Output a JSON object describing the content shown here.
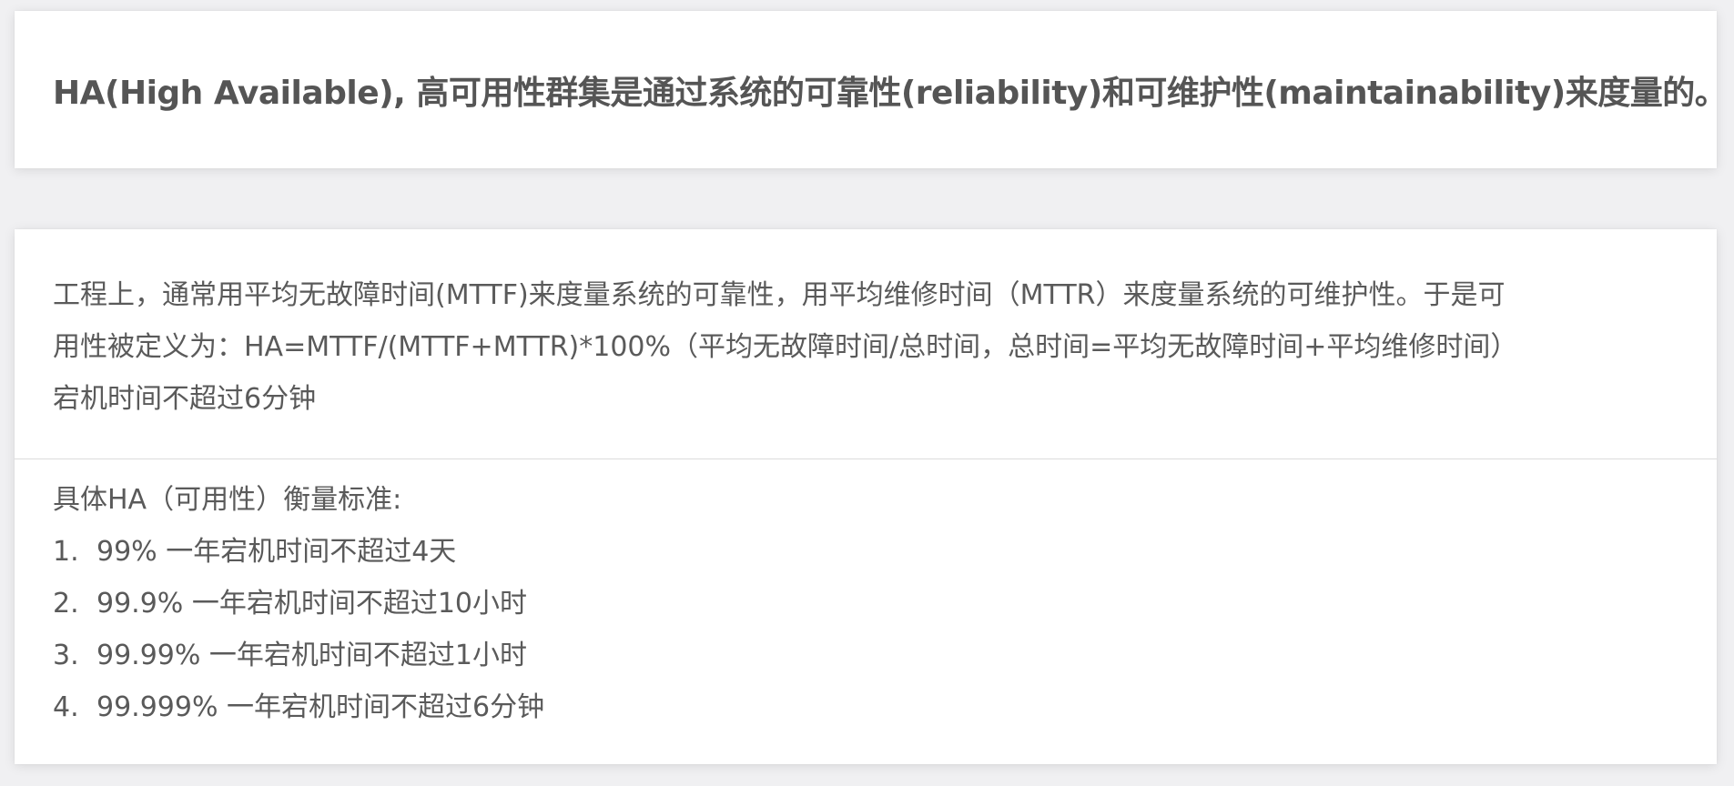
{
  "header": {
    "title": "HA(High Available), 高可用性群集是通过系统的可靠性(reliability)和可维护性(maintainability)来度量的。"
  },
  "definition": {
    "lines": [
      "工程上，通常用平均无故障时间(MTTF)来度量系统的可靠性，用平均维修时间（MTTR）来度量系统的可维护性。于是可",
      "用性被定义为：HA=MTTF/(MTTF+MTTR)*100%（平均无故障时间/总时间，总时间=平均无故障时间+平均维修时间）",
      "宕机时间不超过6分钟"
    ]
  },
  "standards": {
    "subtitle": "具体HA（可用性）衡量标准:",
    "items": [
      {
        "num": "1.",
        "text": "99% 一年宕机时间不超过4天"
      },
      {
        "num": "2.",
        "text": "99.9% 一年宕机时间不超过10小时"
      },
      {
        "num": "3.",
        "text": "99.99% 一年宕机时间不超过1小时"
      },
      {
        "num": "4.",
        "text": "99.999% 一年宕机时间不超过6分钟"
      }
    ]
  }
}
